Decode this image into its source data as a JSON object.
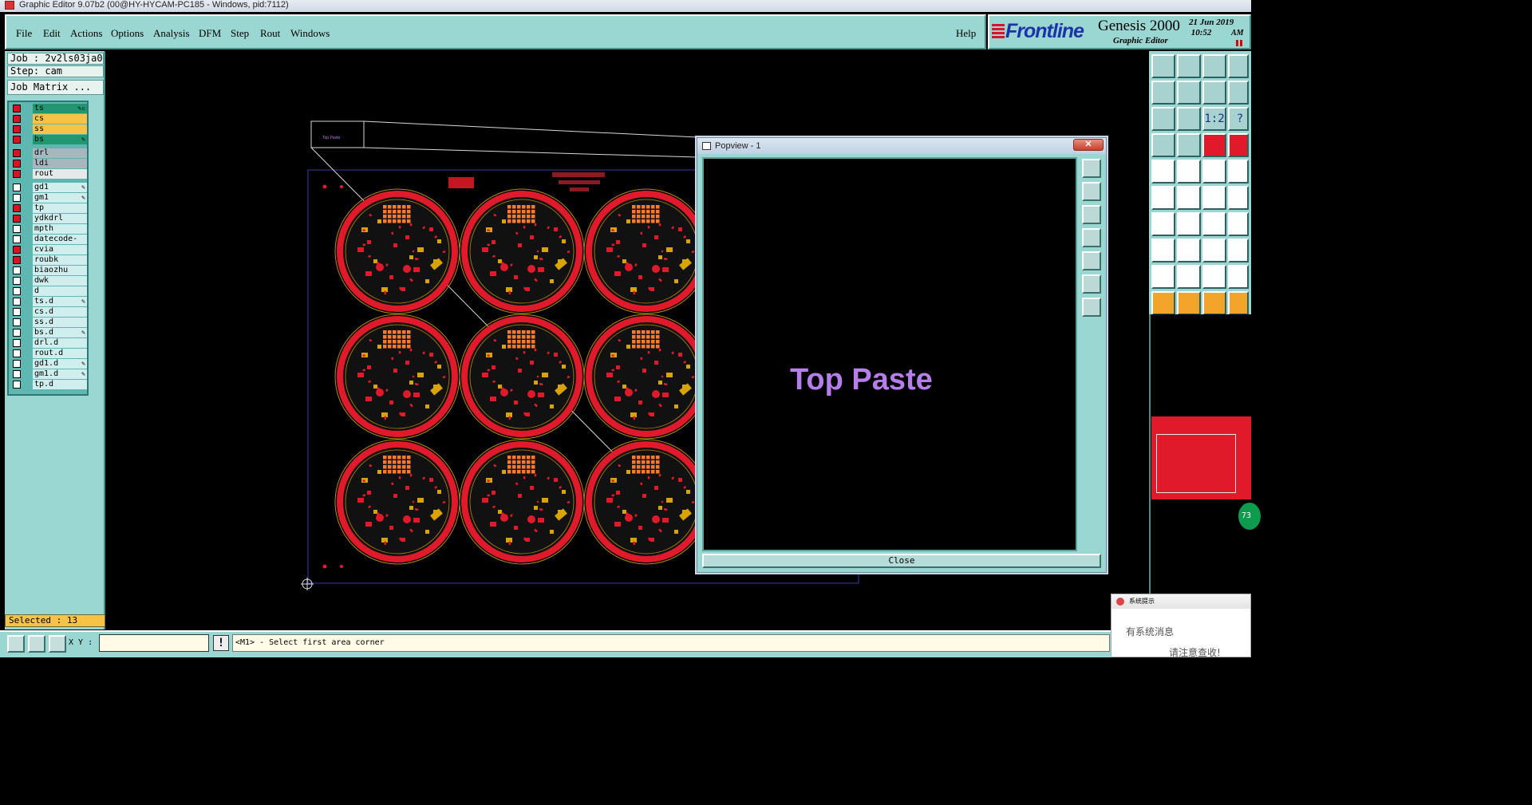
{
  "window": {
    "title": "Graphic Editor 9.07b2 (00@HY-HYCAM-PC185 - Windows, pid:7112)"
  },
  "menu": [
    {
      "label": "File"
    },
    {
      "label": "Edit"
    },
    {
      "label": "Actions"
    },
    {
      "label": "Options"
    },
    {
      "label": "Analysis"
    },
    {
      "label": "DFM"
    },
    {
      "label": "Step"
    },
    {
      "label": "Rout"
    },
    {
      "label": "Windows"
    }
  ],
  "help_label": "Help",
  "branding": {
    "company": "Frontline",
    "product": "Genesis 2000",
    "product_sub": "Graphic Editor",
    "date": "21 Jun 2019",
    "time": "10:52",
    "ampm": "AM"
  },
  "job": {
    "job_line": "Job : 2v2ls03ja0",
    "step_line": "Step: cam",
    "matrix_button": "Job Matrix ..."
  },
  "layers": [
    {
      "name": "ts",
      "color": "green",
      "checked": "red",
      "flag": "✎▫"
    },
    {
      "name": "cs",
      "color": "orange",
      "checked": "red",
      "flag": ""
    },
    {
      "name": "ss",
      "color": "orange",
      "checked": "red",
      "flag": ""
    },
    {
      "name": "bs",
      "color": "green",
      "checked": "red",
      "flag": "✎"
    },
    {
      "name": "drl",
      "color": "gray",
      "checked": "red",
      "flag": ""
    },
    {
      "name": "ldi",
      "color": "gray",
      "checked": "red",
      "flag": ""
    },
    {
      "name": "rout",
      "color": "light",
      "checked": "red",
      "flag": ""
    },
    {
      "name": "gd1",
      "color": "default",
      "checked": "none",
      "flag": "✎"
    },
    {
      "name": "gm1",
      "color": "default",
      "checked": "none",
      "flag": "✎"
    },
    {
      "name": "tp",
      "color": "default",
      "checked": "red",
      "flag": ""
    },
    {
      "name": "ydkdrl",
      "color": "default",
      "checked": "red",
      "flag": ""
    },
    {
      "name": "mpth",
      "color": "default",
      "checked": "none",
      "flag": ""
    },
    {
      "name": "datecode-ts",
      "color": "default",
      "checked": "none",
      "flag": ""
    },
    {
      "name": "cvia",
      "color": "default",
      "checked": "red",
      "flag": ""
    },
    {
      "name": "roubk",
      "color": "default",
      "checked": "red",
      "flag": ""
    },
    {
      "name": "biaozhu",
      "color": "default",
      "checked": "none",
      "flag": ""
    },
    {
      "name": "dwk",
      "color": "default",
      "checked": "none",
      "flag": ""
    },
    {
      "name": "d",
      "color": "default",
      "checked": "none",
      "flag": ""
    },
    {
      "name": "ts.d",
      "color": "default",
      "checked": "none",
      "flag": "✎"
    },
    {
      "name": "cs.d",
      "color": "default",
      "checked": "none",
      "flag": ""
    },
    {
      "name": "ss.d",
      "color": "default",
      "checked": "none",
      "flag": ""
    },
    {
      "name": "bs.d",
      "color": "default",
      "checked": "none",
      "flag": "✎"
    },
    {
      "name": "drl.d",
      "color": "default",
      "checked": "none",
      "flag": ""
    },
    {
      "name": "rout.d",
      "color": "default",
      "checked": "none",
      "flag": ""
    },
    {
      "name": "gd1.d",
      "color": "default",
      "checked": "none",
      "flag": "✎"
    },
    {
      "name": "gm1.d",
      "color": "default",
      "checked": "none",
      "flag": "✎"
    },
    {
      "name": "tp.d",
      "color": "default",
      "checked": "none",
      "flag": ""
    }
  ],
  "selected_label": "Selected : 13",
  "coordinates": {
    "label": "X Y :",
    "value": ""
  },
  "status_message": "<M1> - Select first area corner",
  "canvas": {
    "zoom_box_label": "Top Paste"
  },
  "popview": {
    "title": "Popview - 1",
    "content_text": "Top Paste",
    "close_label": "Close",
    "close_x": "✕"
  },
  "one_to_two_label": "1:2",
  "help_q": "?",
  "notification": {
    "title": "系统提示",
    "line1": "有系统消息",
    "line2": "请注意查收!"
  },
  "badge_text": "73",
  "colors": {
    "panel": "#9ad6d2",
    "copper_red": "#e01a2a",
    "accent_orange": "#f7c347",
    "popup_text": "#b57ee8"
  }
}
